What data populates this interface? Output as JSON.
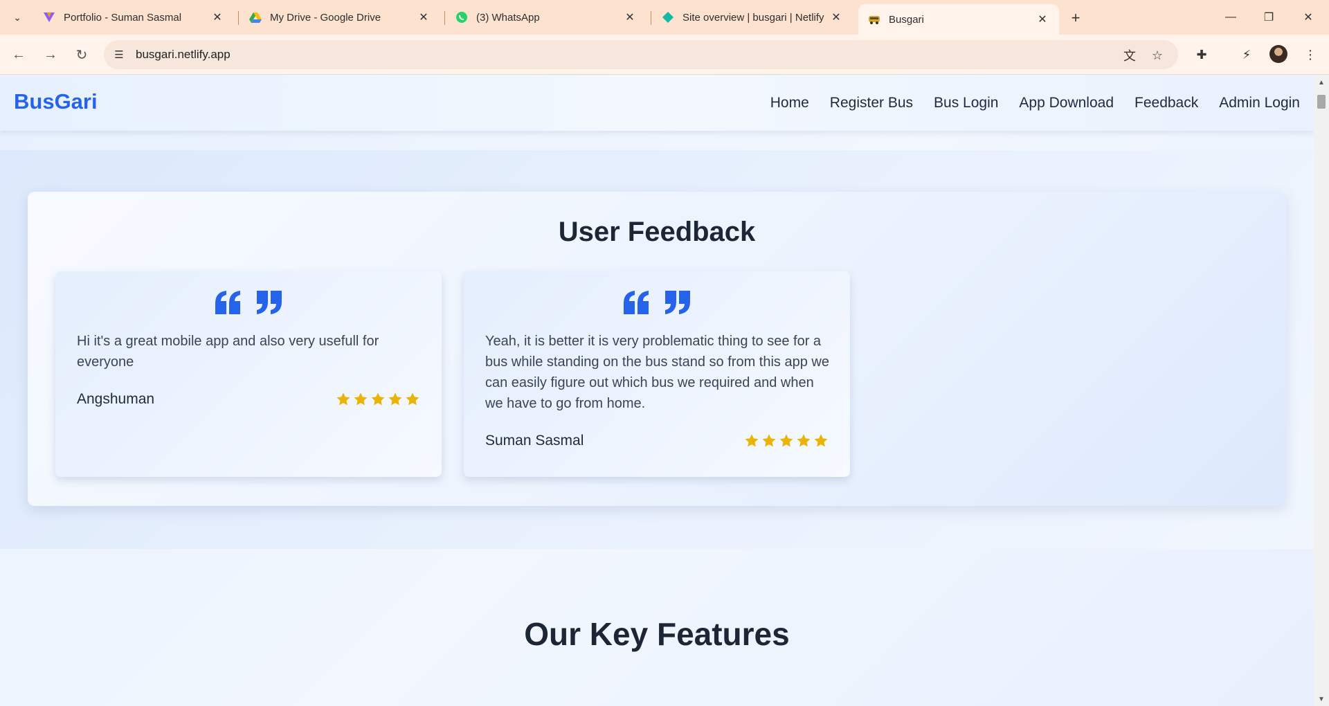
{
  "browser": {
    "tabs": [
      {
        "title": "Portfolio - Suman Sasmal",
        "icon": "portfolio-logo-icon"
      },
      {
        "title": "My Drive - Google Drive",
        "icon": "google-drive-icon"
      },
      {
        "title": "(3) WhatsApp",
        "icon": "whatsapp-icon"
      },
      {
        "title": "Site overview | busgari | Netlify",
        "icon": "netlify-icon"
      },
      {
        "title": "Busgari",
        "icon": "busgari-favicon-icon",
        "active": true
      }
    ],
    "url": "busgari.netlify.app"
  },
  "site": {
    "brand": "BusGari",
    "nav": [
      "Home",
      "Register Bus",
      "Bus Login",
      "App Download",
      "Feedback",
      "Admin Login"
    ]
  },
  "feedback": {
    "title": "User Feedback",
    "items": [
      {
        "text": "Hi it's a great mobile app and also very usefull for everyone",
        "author": "Angshuman",
        "rating": 5
      },
      {
        "text": "Yeah, it is better it is very problematic thing to see for a bus while standing on the bus stand so from this app we can easily figure out which bus we required and when we have to go from home.",
        "author": "Suman Sasmal",
        "rating": 5
      }
    ]
  },
  "features": {
    "title": "Our Key Features"
  },
  "colors": {
    "brand": "#2563eb",
    "star": "#eab308",
    "tabbar": "#fde2cf"
  }
}
